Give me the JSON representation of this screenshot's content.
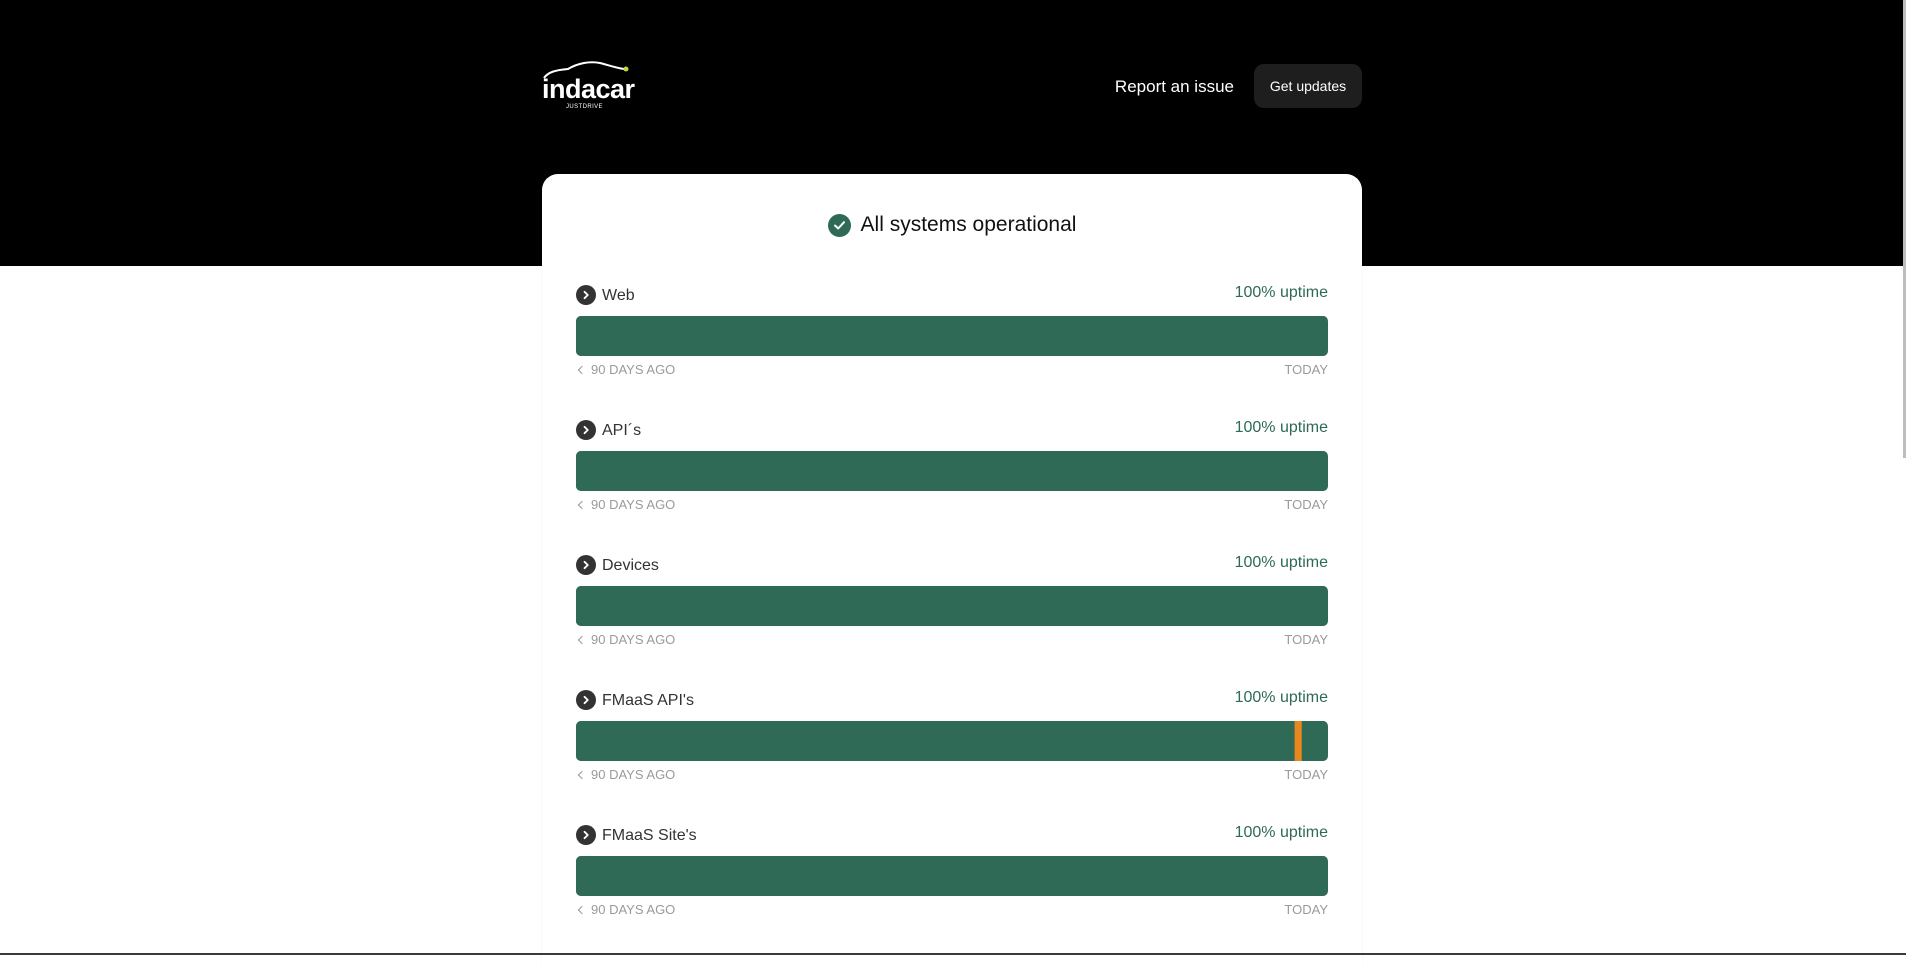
{
  "brand": {
    "name": "indacar",
    "tagline": "JUSTDRIVE"
  },
  "header": {
    "report_label": "Report an issue",
    "updates_label": "Get updates"
  },
  "status": {
    "text": "All systems operational",
    "icon": "check-circle-icon"
  },
  "colors": {
    "operational": "#2e6a55",
    "incident": "#e8871e",
    "hero": "#000000"
  },
  "timeline": {
    "days": 90,
    "start_label": "90 DAYS AGO",
    "end_label": "TODAY"
  },
  "components": [
    {
      "name": "Web",
      "uptime": "100% uptime",
      "incident_days_ago": []
    },
    {
      "name": "API´s",
      "uptime": "100% uptime",
      "incident_days_ago": []
    },
    {
      "name": "Devices",
      "uptime": "100% uptime",
      "incident_days_ago": []
    },
    {
      "name": "FMaaS API's",
      "uptime": "100% uptime",
      "incident_days_ago": [
        3
      ]
    },
    {
      "name": "FMaaS Site's",
      "uptime": "100% uptime",
      "incident_days_ago": []
    }
  ]
}
